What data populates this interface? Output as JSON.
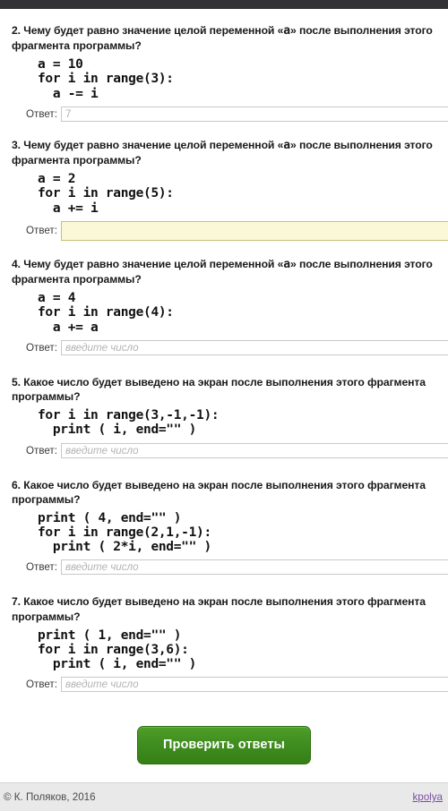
{
  "colors": {
    "topbar": "#333336",
    "button_green": "#3f8c1f",
    "focus_field_bg": "#fbf8d8",
    "focus_field_border": "#c9bf7a",
    "footer_bg": "#e9e9ea",
    "link_purple": "#7b4ea0"
  },
  "answer_label": "Ответ:",
  "questions": [
    {
      "number": "2",
      "title": "2. Чему будет равно значение целой переменной «a» после выполнения этого фрагмента программы?",
      "title_prefix": "2. Чему будет равно значение целой переменной ",
      "title_var": "a",
      "title_suffix": " после выполнения этого фрагмента программы?",
      "code": "a = 10\nfor i in range(3):\n  a -= i",
      "answer_value": "",
      "answer_placeholder": "7",
      "focused": false
    },
    {
      "number": "3",
      "title": "3. Чему будет равно значение целой переменной «a» после выполнения этого фрагмента программы?",
      "title_prefix": "3. Чему будет равно значение целой переменной ",
      "title_var": "a",
      "title_suffix": " после выполнения этого фрагмента программы?",
      "code": "a = 2\nfor i in range(5):\n  a += i",
      "answer_value": "",
      "answer_placeholder": "",
      "focused": true
    },
    {
      "number": "4",
      "title": "4. Чему будет равно значение целой переменной «a» после выполнения этого фрагмента программы?",
      "title_prefix": "4. Чему будет равно значение целой переменной ",
      "title_var": "a",
      "title_suffix": " после выполнения этого фрагмента программы?",
      "code": "a = 4\nfor i in range(4):\n  a += a",
      "answer_value": "",
      "answer_placeholder": "введите число",
      "focused": false
    },
    {
      "number": "5",
      "title": "5. Какое число будет выведено на экран после выполнения этого фрагмента программы?",
      "title_prefix": "5. Какое число будет выведено на экран после выполнения этого фрагмента программы?",
      "title_var": "",
      "title_suffix": "",
      "code": "for i in range(3,-1,-1):\n  print ( i, end=\"\" )",
      "answer_value": "",
      "answer_placeholder": "введите число",
      "focused": false
    },
    {
      "number": "6",
      "title": "6. Какое число будет выведено на экран после выполнения этого фрагмента программы?",
      "title_prefix": "6. Какое число будет выведено на экран после выполнения этого фрагмента программы?",
      "title_var": "",
      "title_suffix": "",
      "code": "print ( 4, end=\"\" )\nfor i in range(2,1,-1):\n  print ( 2*i, end=\"\" )",
      "answer_value": "",
      "answer_placeholder": "введите число",
      "focused": false
    },
    {
      "number": "7",
      "title": "7. Какое число будет выведено на экран после выполнения этого фрагмента программы?",
      "title_prefix": "7. Какое число будет выведено на экран после выполнения этого фрагмента программы?",
      "title_var": "",
      "title_suffix": "",
      "code": "print ( 1, end=\"\" )\nfor i in range(3,6):\n  print ( i, end=\"\" )",
      "answer_value": "",
      "answer_placeholder": "введите число",
      "focused": false
    }
  ],
  "submit_button": {
    "label": "Проверить ответы"
  },
  "footer": {
    "copyright": "© К. Поляков, 2016",
    "link": "kpolya"
  }
}
